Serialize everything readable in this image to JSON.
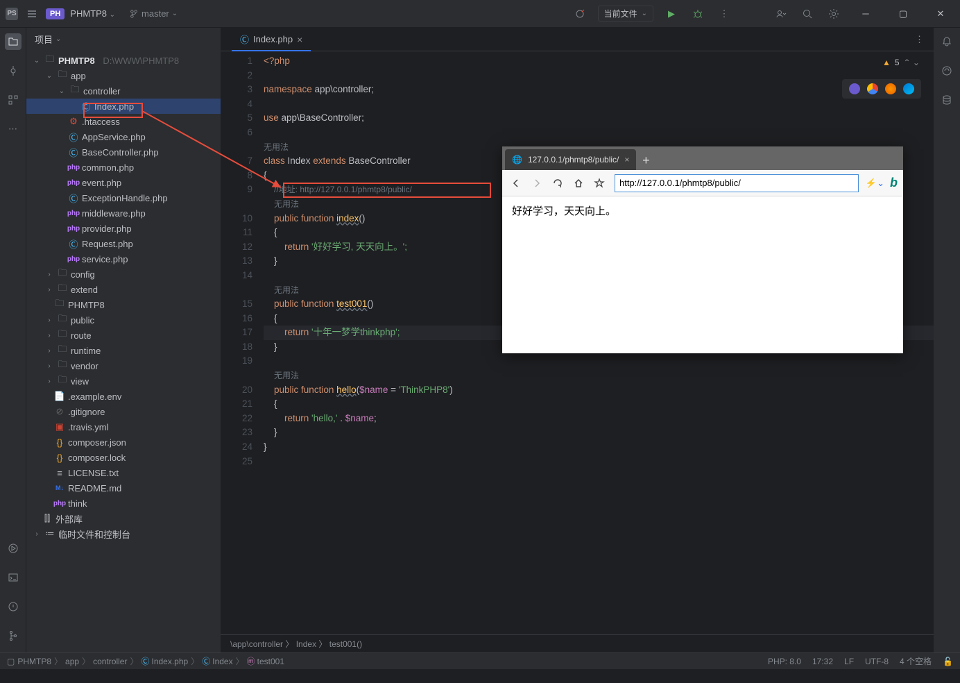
{
  "titlebar": {
    "ps_label": "PS",
    "ph_badge": "PH",
    "project": "PHMTP8",
    "branch": "master",
    "run_config": "当前文件"
  },
  "project": {
    "header": "项目",
    "root": "PHMTP8",
    "root_path": "D:\\WWW\\PHMTP8",
    "tree": {
      "app": "app",
      "controller": "controller",
      "index_php": "Index.php",
      "htaccess": ".htaccess",
      "appservice": "AppService.php",
      "basecontroller": "BaseController.php",
      "common": "common.php",
      "event": "event.php",
      "exceptionhandle": "ExceptionHandle.php",
      "middleware": "middleware.php",
      "provider": "provider.php",
      "request": "Request.php",
      "service": "service.php",
      "config": "config",
      "extend": "extend",
      "phmtp8_folder": "PHMTP8",
      "public": "public",
      "route": "route",
      "runtime": "runtime",
      "vendor": "vendor",
      "view": "view",
      "example_env": ".example.env",
      "gitignore": ".gitignore",
      "travis": ".travis.yml",
      "composer_json": "composer.json",
      "composer_lock": "composer.lock",
      "license": "LICENSE.txt",
      "readme": "README.md",
      "think": "think",
      "external_libs": "外部库",
      "scratches": "临时文件和控制台"
    }
  },
  "editor": {
    "tab_name": "Index.php",
    "warnings": "5",
    "breadcrumb": "\\app\\controller 〉 Index 〉 test001()",
    "hint_unused": "无用法",
    "lines": {
      "l1_php": "<?php",
      "l3_namespace": "namespace",
      "l3_ns_val": " app\\controller;",
      "l5_use": "use",
      "l5_use_val": " app\\BaseController;",
      "l7_class": "class",
      "l7_name": " Index ",
      "l7_extends": "extends",
      "l7_base": " BaseController",
      "l8_brace": "{",
      "l9_comment": "//地址: http://127.0.0.1/phmtp8/public/",
      "l10_public": "public",
      "l10_function": " function ",
      "l10_name": "index",
      "l10_paren": "()",
      "l11_brace": "{",
      "l12_return": "return",
      "l12_str": " '好好学习, 天天向上。';",
      "l13_brace": "}",
      "l15_public": "public",
      "l15_function": " function ",
      "l15_name": "test001",
      "l15_paren": "()",
      "l16_brace": "{",
      "l17_return": "return",
      "l17_str": " '十年一梦学thinkphp';",
      "l18_brace": "}",
      "l20_public": "public",
      "l20_function": " function ",
      "l20_name": "hello",
      "l20_args_open": "(",
      "l20_var": "$name",
      "l20_default": " = ",
      "l20_defstr": "'ThinkPHP8'",
      "l20_close": ")",
      "l21_brace": "{",
      "l22_return": "return",
      "l22_str1": " 'hello,'",
      "l22_concat": " . ",
      "l22_var": "$name",
      "l22_semi": ";",
      "l23_brace": "}",
      "l24_brace": "}"
    }
  },
  "browser": {
    "tab_title": "127.0.0.1/phmtp8/public/",
    "url": "http://127.0.0.1/phmtp8/public/",
    "content": "好好学习，天天向上。"
  },
  "statusbar": {
    "crumb_root": "PHMTP8",
    "crumb_app": "app",
    "crumb_controller": "controller",
    "crumb_file": "Index.php",
    "crumb_class": "Index",
    "crumb_method": "test001",
    "php_ver": "PHP: 8.0",
    "time": "17:32",
    "line_end": "LF",
    "encoding": "UTF-8",
    "indent": "4 个空格"
  }
}
